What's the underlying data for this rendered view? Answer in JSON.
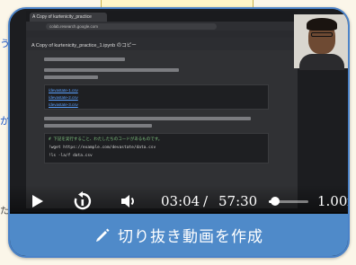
{
  "background": {
    "left_text_top": "う",
    "left_text_mid": "か",
    "left_text_bottom": "た"
  },
  "screen": {
    "tab_title": "A Copy of kurtenicity_practice",
    "url": "colab.research.google.com",
    "notebook_title": "A Copy of kurtenicity_practice_1.ipynb のコピー",
    "menu": "ファイル 編集 表示 挿入 ランタイム ツール ヘルプ",
    "links": [
      "/devastate-1.csv",
      "/devastate-2.csv",
      "/devastate-3.csv"
    ],
    "code_lines": [
      "# 下記を実行すること、わたしたちのコードがあるものです。",
      "!wget https://example.com/devastate/data.csv",
      "!ls -la/f data.csv"
    ]
  },
  "player": {
    "current_time": "03:04",
    "separator": "/",
    "total_time": "57:30",
    "progress_fraction": 0.15,
    "speed": "1.00x"
  },
  "clip_button": {
    "label": "切り抜き動画を作成"
  },
  "colors": {
    "accent": "#4f8ac9",
    "border": "#4a82c8"
  }
}
